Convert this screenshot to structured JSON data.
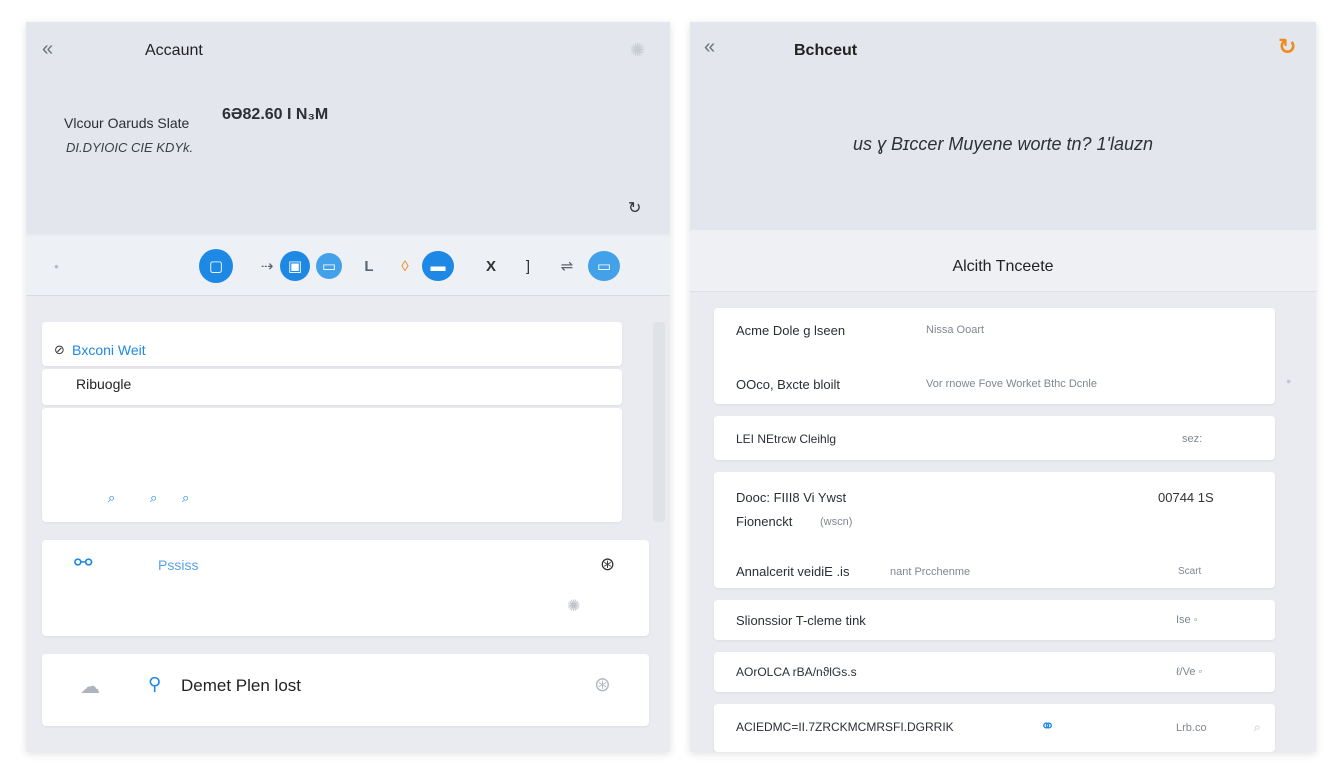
{
  "left": {
    "title": "Accaunt",
    "summary_label": "Vlcour Oaruds Slate",
    "summary_value": "6Ə82.60 I N₃M",
    "summary_sub": "DI.DYIOIC CIE KDYk.",
    "toolbar_icons": [
      "window-icon",
      "layer-icon",
      "monitor-icon",
      "laptop-icon",
      "text-icon",
      "brush-icon",
      "printer-icon",
      "close-icon",
      "divider-icon",
      "link-icon",
      "display-icon"
    ],
    "section_title": "Bxconi Weit",
    "section_item": "Ribuogle",
    "card_label": "Pssiss",
    "bottom_label": "Demet Plen lost"
  },
  "right": {
    "title": "Bchceut",
    "message": "us ɣ Bɪccer Muyene worte tn? 1'lauzn",
    "subheader": "Alcith Tnceete",
    "rows": [
      {
        "label": "Acme Dole g lseen",
        "value": "Nissa Ooart",
        "extra": ""
      },
      {
        "label": "OOco, Bxcte bloilt",
        "value": "Vor rnowe Fove Worket Bthc Dcnle",
        "extra": ""
      },
      {
        "label": "LEI NEtrcw Cleihlg",
        "value": "",
        "extra": "sez:"
      },
      {
        "label": "Dooc: FIII8 Vi Ywst",
        "value": "",
        "extra": "00744 1S"
      },
      {
        "label": "Fionenckt",
        "value": "(wscn)",
        "extra": ""
      },
      {
        "label": "Annalcerit veidiE .is",
        "value": "nant Prcchenme",
        "extra": "Scart"
      },
      {
        "label": "Slionssior T-cleme tink",
        "value": "",
        "extra": "Ise ◦"
      },
      {
        "label": "AOrOLCA rBA/nϑlGs.s",
        "value": "",
        "extra": "ℓ/Ve ◦"
      },
      {
        "label": "ACIEDMC=II.7ZRCKMCMRSFI.DGRRIK",
        "value": "",
        "extra": "Lrb.co"
      }
    ]
  }
}
